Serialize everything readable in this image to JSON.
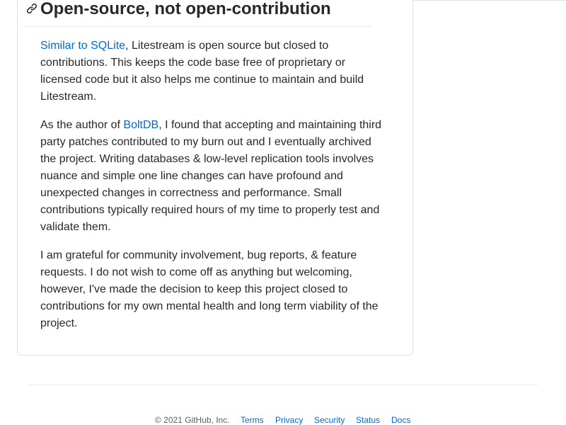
{
  "readme": {
    "heading": "Open-source, not open-contribution",
    "para1": {
      "link": "Similar to SQLite",
      "text": ", Litestream is open source but closed to contributions. This keeps the code base free of proprietary or licensed code but it also helps me continue to maintain and build Litestream."
    },
    "para2": {
      "before": "As the author of ",
      "link": "BoltDB",
      "text": ", I found that accepting and maintaining third party patches contributed to my burn out and I eventually archived the project. Writing databases & low-level replication tools involves nuance and simple one line changes can have profound and unexpected changes in correctness and performance. Small contributions typically required hours of my time to properly test and validate them."
    },
    "para3": "I am grateful for community involvement, bug reports, & feature requests. I do not wish to come off as anything but welcoming, however, I've made the decision to keep this project closed to contributions for my own mental health and long term viability of the project."
  },
  "footer": {
    "copyright": "© 2021 GitHub, Inc.",
    "links": [
      "Terms",
      "Privacy",
      "Security",
      "Status",
      "Docs"
    ]
  },
  "colors": {
    "link": "#0366d6",
    "text": "#24292e",
    "muted": "#586069",
    "border": "#e1e4e8"
  },
  "icons": {
    "anchor": "link-icon"
  }
}
